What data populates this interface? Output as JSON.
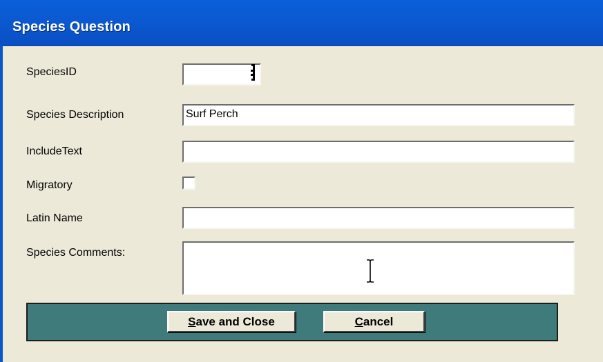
{
  "window": {
    "title": "Species Question"
  },
  "form": {
    "species_id": {
      "label": "SpeciesID",
      "value": ""
    },
    "species_description": {
      "label": "Species Description",
      "value": "Surf Perch"
    },
    "include_text": {
      "label": "IncludeText",
      "value": ""
    },
    "migratory": {
      "label": "Migratory",
      "checked": false
    },
    "latin_name": {
      "label": "Latin Name",
      "value": ""
    },
    "species_comments": {
      "label": "Species Comments:",
      "value": ""
    }
  },
  "buttons": {
    "save_close": {
      "accelerator": "S",
      "rest": "ave and Close"
    },
    "cancel": {
      "accelerator": "C",
      "rest": "ancel"
    }
  },
  "colors": {
    "titlebar": "#0a5fd8",
    "window_bg": "#ece9d8",
    "button_bar": "#3f7b7b"
  },
  "icons": {
    "caret": "text-cursor-icon",
    "mouse": "ibeam-cursor-icon"
  }
}
